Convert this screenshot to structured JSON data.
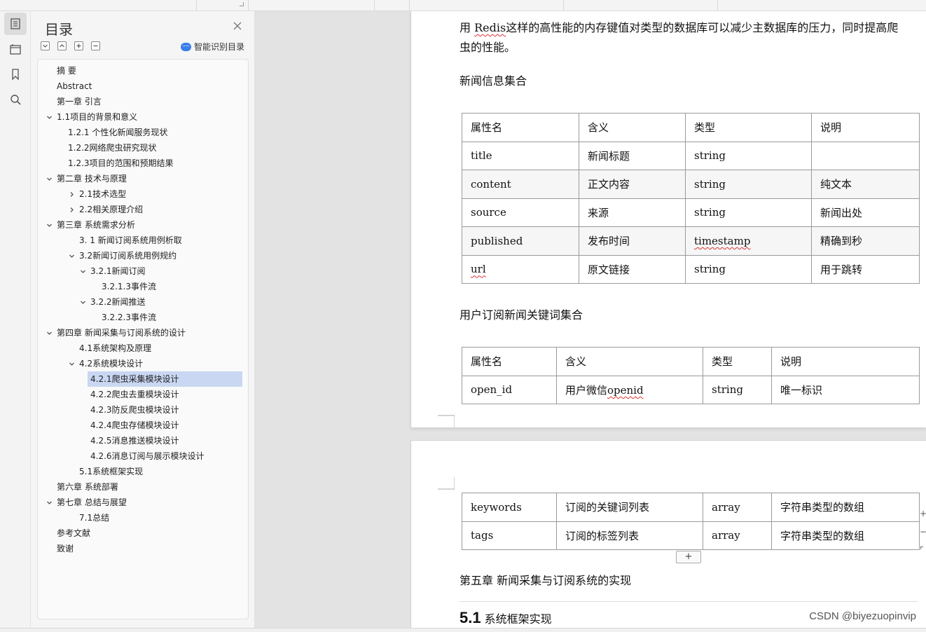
{
  "toc": {
    "title": "目录",
    "ai_label": "智能识别目录",
    "items": [
      {
        "label": "摘  要",
        "level": 0,
        "chev": ""
      },
      {
        "label": "Abstract",
        "level": 0,
        "chev": ""
      },
      {
        "label": "第一章 引言",
        "level": 0,
        "chev": ""
      },
      {
        "label": "1.1项目的背景和意义",
        "level": 0,
        "chev": "down"
      },
      {
        "label": "1.2.1 个性化新闻服务现状",
        "level": 1,
        "chev": ""
      },
      {
        "label": "1.2.2网络爬虫研究现状",
        "level": 1,
        "chev": ""
      },
      {
        "label": "1.2.3项目的范围和预期结果",
        "level": 1,
        "chev": ""
      },
      {
        "label": "第二章 技术与原理",
        "level": 0,
        "chev": "down"
      },
      {
        "label": "2.1技术选型",
        "level": 2,
        "chev": "right"
      },
      {
        "label": "2.2相关原理介绍",
        "level": 2,
        "chev": "right"
      },
      {
        "label": "第三章 系统需求分析",
        "level": 0,
        "chev": "down"
      },
      {
        "label": "3. 1 新闻订阅系统用例析取",
        "level": 2,
        "chev": ""
      },
      {
        "label": "3.2新闻订阅系统用例规约",
        "level": 2,
        "chev": "down"
      },
      {
        "label": "3.2.1新闻订阅",
        "level": 3,
        "chev": "down"
      },
      {
        "label": "3.2.1.3事件流",
        "level": 4,
        "chev": ""
      },
      {
        "label": "3.2.2新闻推送",
        "level": 3,
        "chev": "down"
      },
      {
        "label": "3.2.2.3事件流",
        "level": 4,
        "chev": ""
      },
      {
        "label": "第四章 新闻采集与订阅系统的设计",
        "level": 0,
        "chev": "down"
      },
      {
        "label": "4.1系统架构及原理",
        "level": 2,
        "chev": ""
      },
      {
        "label": "4.2系统模块设计",
        "level": 2,
        "chev": "down"
      },
      {
        "label": "4.2.1爬虫采集模块设计",
        "level": 3,
        "chev": "",
        "selected": true
      },
      {
        "label": "4.2.2爬虫去重模块设计",
        "level": 3,
        "chev": ""
      },
      {
        "label": "4.2.3防反爬虫模块设计",
        "level": 3,
        "chev": ""
      },
      {
        "label": "4.2.4爬虫存储模块设计",
        "level": 3,
        "chev": ""
      },
      {
        "label": "4.2.5消息推送模块设计",
        "level": 3,
        "chev": ""
      },
      {
        "label": "4.2.6消息订阅与展示模块设计",
        "level": 3,
        "chev": ""
      },
      {
        "label": "5.1系统框架实现",
        "level": 2,
        "chev": ""
      },
      {
        "label": "第六章 系统部署",
        "level": 0,
        "chev": ""
      },
      {
        "label": "第七章 总结与展望",
        "level": 0,
        "chev": "down"
      },
      {
        "label": "7.1总结",
        "level": 2,
        "chev": ""
      },
      {
        "label": "参考文献",
        "level": 0,
        "chev": ""
      },
      {
        "label": "致谢",
        "level": 0,
        "chev": ""
      }
    ]
  },
  "doc": {
    "para_line1_pre": "用 ",
    "para_line1_word": "Redis",
    "para_line1_post": "这样的高性能的内存键值对类型的数据库可以减少主数据库的压力，同时提高爬",
    "para_line2": "虫的性能。",
    "heading_news": "新闻信息集合",
    "news_table": {
      "headers": [
        "属性名",
        "含义",
        "类型",
        "说明"
      ],
      "rows": [
        [
          "title",
          "新闻标题",
          "string",
          ""
        ],
        [
          "content",
          "正文内容",
          "string",
          "纯文本"
        ],
        [
          "source",
          "来源",
          "string",
          "新闻出处"
        ],
        [
          "published",
          "发布时间",
          "timestamp",
          "精确到秒"
        ],
        [
          "url",
          "原文链接",
          "string",
          "用于跳转"
        ]
      ]
    },
    "heading_sub": "用户订阅新闻关键词集合",
    "sub_table": {
      "headers": [
        "属性名",
        "含义",
        "类型",
        "说明"
      ],
      "rows": [
        [
          "open_id",
          "用户微信openid",
          "string",
          "唯一标识"
        ]
      ],
      "openid_prefix": "用户微信",
      "openid_word": "openid"
    },
    "sub_table_cont": {
      "rows": [
        [
          "keywords",
          "订阅的关键词列表",
          "array",
          "字符串类型的数组"
        ],
        [
          "tags",
          "订阅的标签列表",
          "array",
          "字符串类型的数组"
        ]
      ]
    },
    "add_row_label": "+",
    "chapter5": "第五章 新闻采集与订阅系统的实现",
    "h51_num": "5.1",
    "h51_text": " 系统框架实现",
    "watermark": "CSDN @biyezuopinvip"
  },
  "right_edge_symbols": [
    "+",
    "−",
    "⌜"
  ]
}
